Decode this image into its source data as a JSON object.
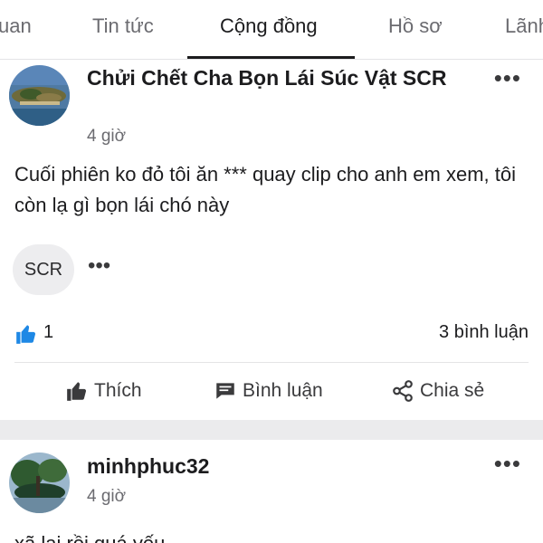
{
  "tabs": [
    {
      "label": "uan"
    },
    {
      "label": "Tin tức"
    },
    {
      "label": "Cộng đồng",
      "active": true
    },
    {
      "label": "Hồ sơ"
    },
    {
      "label": "Lãnh"
    }
  ],
  "posts": [
    {
      "author": "Chửi Chết Cha Bọn Lái Súc Vật SCR",
      "time": "4 giờ",
      "more": "•••",
      "content": "Cuối phiên ko đỏ tôi ăn *** quay clip cho anh em xem, tôi còn lạ gì bọn lái chó này",
      "tag": "SCR",
      "tag_more": "•••",
      "likes": "1",
      "comments": "3 bình luận",
      "actions": {
        "like": "Thích",
        "comment": "Bình luận",
        "share": "Chia sẻ"
      }
    },
    {
      "author": "minhphuc32",
      "time": "4 giờ",
      "more": "•••",
      "content": "xã lại rồi quá yếu"
    }
  ],
  "colors": {
    "accent": "#1e88e5",
    "text": "#1c1c1e",
    "muted": "#6b6b70"
  },
  "icons": [
    "thumbs-up-icon",
    "comment-icon",
    "share-icon",
    "more-icon"
  ]
}
